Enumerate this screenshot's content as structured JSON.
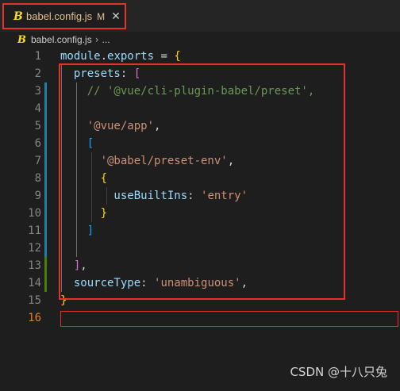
{
  "tab": {
    "icon": "babel-icon",
    "icon_glyph": "B",
    "filename": "babel.config.js",
    "modified": "M",
    "close": "✕"
  },
  "breadcrumb": {
    "icon_glyph": "B",
    "file": "babel.config.js",
    "sep": "›",
    "more": "..."
  },
  "editor": {
    "line_numbers": [
      "1",
      "2",
      "3",
      "4",
      "5",
      "6",
      "7",
      "8",
      "9",
      "10",
      "11",
      "12",
      "13",
      "14",
      "15",
      "16"
    ],
    "active_line": "16",
    "lines": [
      [
        {
          "t": "module",
          "c": "t-id"
        },
        {
          "t": ".",
          "c": "t-op"
        },
        {
          "t": "exports",
          "c": "t-id"
        },
        {
          "t": " = ",
          "c": "t-op"
        },
        {
          "t": "{",
          "c": "t-b1"
        }
      ],
      [
        {
          "t": "  presets",
          "c": "t-id"
        },
        {
          "t": ": ",
          "c": "t-op"
        },
        {
          "t": "[",
          "c": "t-b2"
        }
      ],
      [
        {
          "t": "    // '@vue/cli-plugin-babel/preset',",
          "c": "t-com"
        }
      ],
      [],
      [
        {
          "t": "    '@vue/app'",
          "c": "t-str"
        },
        {
          "t": ",",
          "c": "t-op"
        }
      ],
      [
        {
          "t": "    [",
          "c": "t-b3"
        }
      ],
      [
        {
          "t": "      '@babel/preset-env'",
          "c": "t-str"
        },
        {
          "t": ",",
          "c": "t-op"
        }
      ],
      [
        {
          "t": "      {",
          "c": "t-b1"
        }
      ],
      [
        {
          "t": "        useBuiltIns",
          "c": "t-id"
        },
        {
          "t": ": ",
          "c": "t-op"
        },
        {
          "t": "'entry'",
          "c": "t-str"
        }
      ],
      [
        {
          "t": "      }",
          "c": "t-b1"
        }
      ],
      [
        {
          "t": "    ]",
          "c": "t-b3"
        }
      ],
      [],
      [
        {
          "t": "  ]",
          "c": "t-b2"
        },
        {
          "t": ",",
          "c": "t-op"
        }
      ],
      [
        {
          "t": "  sourceType",
          "c": "t-id"
        },
        {
          "t": ": ",
          "c": "t-op"
        },
        {
          "t": "'unambiguous'",
          "c": "t-str"
        },
        {
          "t": ",",
          "c": "t-op"
        }
      ],
      [
        {
          "t": "}",
          "c": "t-b1"
        }
      ],
      []
    ]
  },
  "watermark": "CSDN @十八只兔"
}
